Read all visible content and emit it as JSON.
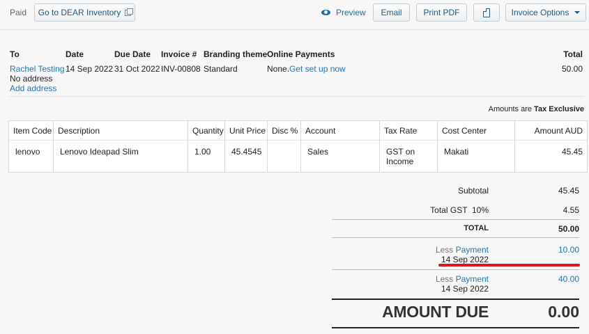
{
  "toolbar": {
    "status": "Paid",
    "dear_button": "Go to DEAR Inventory",
    "preview": "Preview",
    "email": "Email",
    "print_pdf": "Print PDF",
    "invoice_options": "Invoice Options"
  },
  "header": {
    "labels": {
      "to": "To",
      "date": "Date",
      "due_date": "Due Date",
      "invoice_no": "Invoice #",
      "branding": "Branding theme",
      "online_payments": "Online Payments",
      "total": "Total"
    },
    "values": {
      "to_name": "Rachel Testing",
      "no_address": "No address",
      "add_address": "Add address",
      "date": "14 Sep 2022",
      "due_date": "31 Oct 2022",
      "invoice_no": "INV-00808",
      "branding": "Standard",
      "online_payments_prefix": "None.",
      "online_payments_link": "Get set up now",
      "total": "50.00"
    }
  },
  "tax_note": {
    "prefix": "Amounts are",
    "mode": "Tax Exclusive"
  },
  "line_items": {
    "columns": [
      "Item Code",
      "Description",
      "Quantity",
      "Unit Price",
      "Disc %",
      "Account",
      "Tax Rate",
      "Cost Center",
      "Amount AUD"
    ],
    "rows": [
      {
        "item_code": "lenovo",
        "description": "Lenovo Ideapad Slim",
        "quantity": "1.00",
        "unit_price": "45.4545",
        "disc": "",
        "account": "Sales",
        "tax_rate_1": "GST on",
        "tax_rate_2": "Income",
        "cost_center": "Makati",
        "amount": "45.45"
      }
    ]
  },
  "totals": {
    "subtotal_label": "Subtotal",
    "subtotal": "45.45",
    "gst_label": "Total GST  10%",
    "gst": "4.55",
    "total_label": "TOTAL",
    "total": "50.00",
    "payments": [
      {
        "less": "Less",
        "link": "Payment",
        "date": "14 Sep 2022",
        "amount": "10.00"
      },
      {
        "less": "Less",
        "link": "Payment",
        "date": "14 Sep 2022",
        "amount": "40.00"
      }
    ],
    "amount_due_label": "AMOUNT DUE",
    "amount_due": "0.00"
  },
  "colors": {
    "link": "#1f78b4",
    "button_text": "#1f5b82",
    "highlight": "#e0141e"
  },
  "icons": [
    "external-link-icon",
    "eye-icon",
    "copy-document-icon",
    "chevron-down-icon"
  ]
}
